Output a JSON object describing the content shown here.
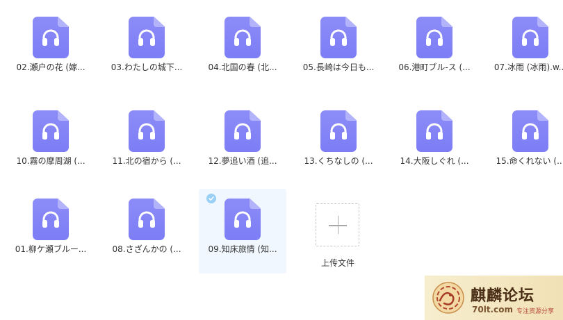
{
  "files": [
    {
      "name": "02.瀬户の花 (嫁..."
    },
    {
      "name": "03.わたしの城下..."
    },
    {
      "name": "04.北国の春 (北..."
    },
    {
      "name": "05.長崎は今日も..."
    },
    {
      "name": "06.港町ブル-ス (..."
    },
    {
      "name": "07.冰雨 (冰雨).w..."
    },
    {
      "name": "10.霧の摩周湖 (..."
    },
    {
      "name": "11.北の宿から (..."
    },
    {
      "name": "12.夢追い酒 (追..."
    },
    {
      "name": "13.くちなしの (..."
    },
    {
      "name": "14.大阪しぐれ (..."
    },
    {
      "name": "15.命くれない (..."
    },
    {
      "name": "01.柳ケ瀬ブルー..."
    },
    {
      "name": "08.さざんかの (..."
    },
    {
      "name": "09.知床旅情 (知...",
      "selected": true
    }
  ],
  "upload": {
    "label": "上传文件"
  },
  "icons": {
    "file": "audio-file-headphones-icon",
    "upload": "plus-icon",
    "check": "check-circle-icon"
  },
  "colors": {
    "file_icon": "#8585f7",
    "selected_bg": "#f0f7fe",
    "check": "#9ad0f5"
  },
  "watermark": {
    "title": "麒麟论坛",
    "domain": "70lt.com",
    "tagline": "专注资源分享"
  }
}
